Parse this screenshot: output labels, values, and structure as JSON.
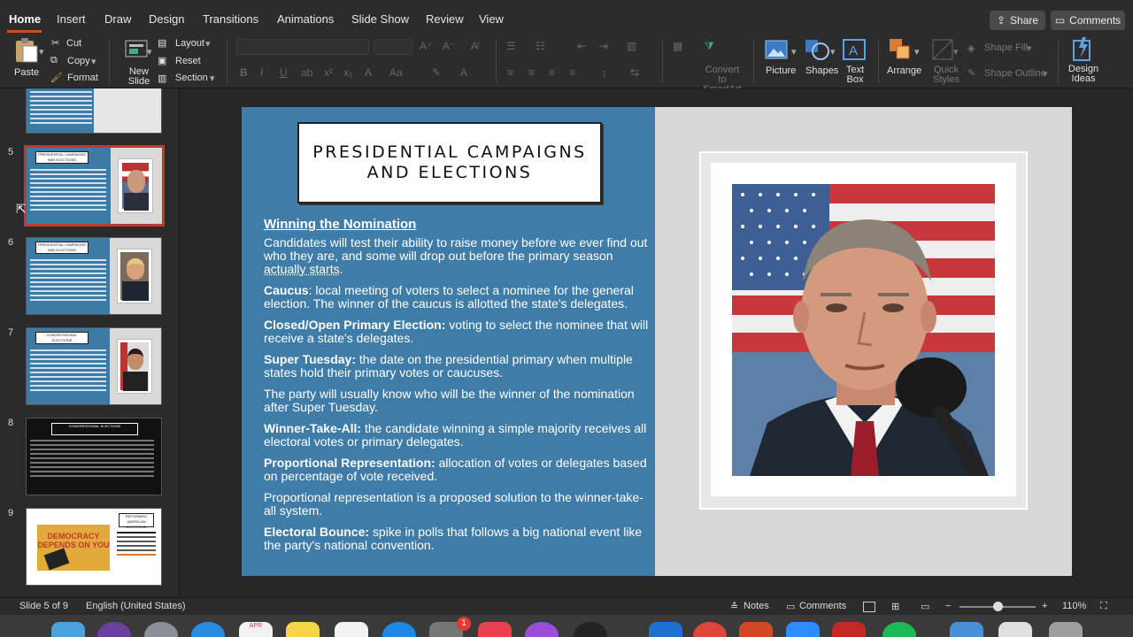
{
  "tabs": [
    "Home",
    "Insert",
    "Draw",
    "Design",
    "Transitions",
    "Animations",
    "Slide Show",
    "Review",
    "View"
  ],
  "top_buttons": {
    "share": "Share",
    "comments": "Comments"
  },
  "ribbon": {
    "paste": "Paste",
    "cut": "Cut",
    "copy": "Copy",
    "format": "Format",
    "new_slide": "New Slide",
    "layout": "Layout",
    "reset": "Reset",
    "section": "Section",
    "convert": "Convert to SmartArt",
    "picture": "Picture",
    "shapes": "Shapes",
    "text_box": "Text Box",
    "arrange": "Arrange",
    "quick_styles": "Quick Styles",
    "shape_fill": "Shape Fill",
    "shape_outline": "Shape Outline",
    "design_ideas": "Design Ideas"
  },
  "thumbnails": {
    "numbers": [
      "5",
      "6",
      "7",
      "8",
      "9"
    ],
    "slide6_title": "PRESIDENTIAL CAMPAIGNS AND ELECTIONS",
    "slide7_title": "CONGRESSIONAL ELECTIONS",
    "slide8_title": "CONGRESSIONAL ELECTIONS",
    "slide9_title": "REFORMING AMERICAN ELECTIONS",
    "slide9_image_text": "DEMOCRACY DEPENDS ON YOU"
  },
  "slide": {
    "title": "PRESIDENTIAL CAMPAIGNS AND ELECTIONS",
    "heading": "Winning the Nomination",
    "p1_a": "Candidates will test their ability to raise money before we ever find out who they are, and some will drop out before the primary season ",
    "p1_b": "actually starts",
    "p1_c": ".",
    "caucus_term": "Caucus",
    "caucus_def": ": local meeting of voters to select a nominee for the general election. The winner of the caucus is allotted the state's delegates.",
    "closed_term": "Closed/Open Primary Election:",
    "closed_def": " voting to select the nominee that will receive a state's delegates.",
    "super_term": "Super Tuesday:",
    "super_def": " the date on the presidential primary when multiple states hold their primary votes or caucuses.",
    "party_text": "The party will usually know who will be the winner of the nomination after Super Tuesday.",
    "wta_term": "Winner-Take-All:",
    "wta_def": " the candidate winning a simple majority receives all electoral votes or primary delegates.",
    "prop_term": "Proportional Representation:",
    "prop_def": " allocation of votes or delegates based on percentage of vote received.",
    "prop_text": "Proportional representation is a proposed solution to the winner-take-all system.",
    "bounce_term": "Electoral Bounce:",
    "bounce_def": " spike in polls that follows a big national event like the party's national convention."
  },
  "status": {
    "slide_info": "Slide 5 of 9",
    "language": "English (United States)",
    "notes": "Notes",
    "comments": "Comments",
    "zoom": "110%"
  },
  "dock": {
    "badge": "1",
    "calendar_month": "APR"
  },
  "colors": {
    "accent": "#d24726",
    "slide_blue": "#3f7ca8",
    "selected_border": "#c0392b"
  }
}
